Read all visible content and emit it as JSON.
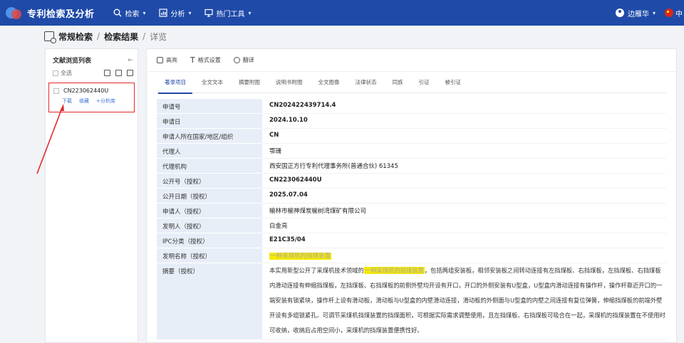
{
  "app": {
    "title": "专利检索及分析"
  },
  "nav": [
    {
      "label": "检索",
      "icon": "search-icon"
    },
    {
      "label": "分析",
      "icon": "chart-icon"
    },
    {
      "label": "热门工具",
      "icon": "monitor-icon"
    }
  ],
  "user": {
    "name": "边雁华",
    "lang": "中"
  },
  "breadcrumb": {
    "home": "常规检索",
    "results": "检索结果",
    "detail": "详览",
    "sep": "/"
  },
  "left_panel": {
    "title": "文献浏览列表",
    "select_all": "全选",
    "item": {
      "number": "CN223062440U",
      "actions": [
        "下载",
        "收藏",
        "+分析库"
      ]
    }
  },
  "toolbar": {
    "highlight": "高亮",
    "format": "格式设置",
    "translate": "翻译"
  },
  "tabs": [
    "著录项目",
    "全文文本",
    "摘要附图",
    "说明书附图",
    "全文图像",
    "法律状态",
    "同族",
    "引证",
    "被引证"
  ],
  "details": [
    {
      "label": "申请号",
      "value": "CN202422439714.4"
    },
    {
      "label": "申请日",
      "value": "2024.10.10"
    },
    {
      "label": "申请人所在国家/地区/组织",
      "value": "CN"
    },
    {
      "label": "代理人",
      "value": "鄂珊"
    },
    {
      "label": "代理机构",
      "value": "西安国正方行专利代理事务所(普通合伙) 61345"
    },
    {
      "label": "公开号（授权）",
      "value": "CN223062440U"
    },
    {
      "label": "公开日期（授权）",
      "value": "2025.07.04"
    },
    {
      "label": "申请人（授权）",
      "value": "榆林市榆神煤炭榆树湾煤矿有限公司"
    },
    {
      "label": "发明人（授权）",
      "value": "白金亮"
    },
    {
      "label": "IPC分类（授权）",
      "value": "E21C35/04"
    },
    {
      "label": "发明名称（授权）",
      "value": "一种采煤机的挡煤装置"
    }
  ],
  "abstract": {
    "label": "摘要（授权）",
    "pre": "本实用新型公开了采煤机技术领域的",
    "highlight": "一种采煤机的挡煤装置",
    "post": "，包括两组安装板，相邻安装板之间转动连接有左挡煤板、右挡煤板，左挡煤板、右挡煤板内滑动连接有伸缩挡煤板，左挡煤板、右挡煤板的前侧外壁均开设有开口，开口的外侧安装有U型盒，U型盒内滑动连接有操作杆，操作杆靠近开口的一端安装有锁紧块，操作杆上设有滑动板，滑动板与U型盒的内壁滑动连接，滑动板的外侧面与U型盒的内壁之间连接有复位弹簧，伸缩挡煤板的前端外壁开设有多组锁紧孔。可调节采煤机挡煤装置的挡煤面积，可根据实际需求调整使用，且左挡煤板、右挡煤板可吸合在一起，采煤机的挡煤装置在不使用时可收纳，收纳后占用空间小，采煤机的挡煤装置便携性好。"
  },
  "colors": {
    "header": "#1f4aa8",
    "accent": "#1f4aa8",
    "label_bg": "#e8eef8",
    "annotation": "#e3282a",
    "highlight": "#f5e800"
  }
}
